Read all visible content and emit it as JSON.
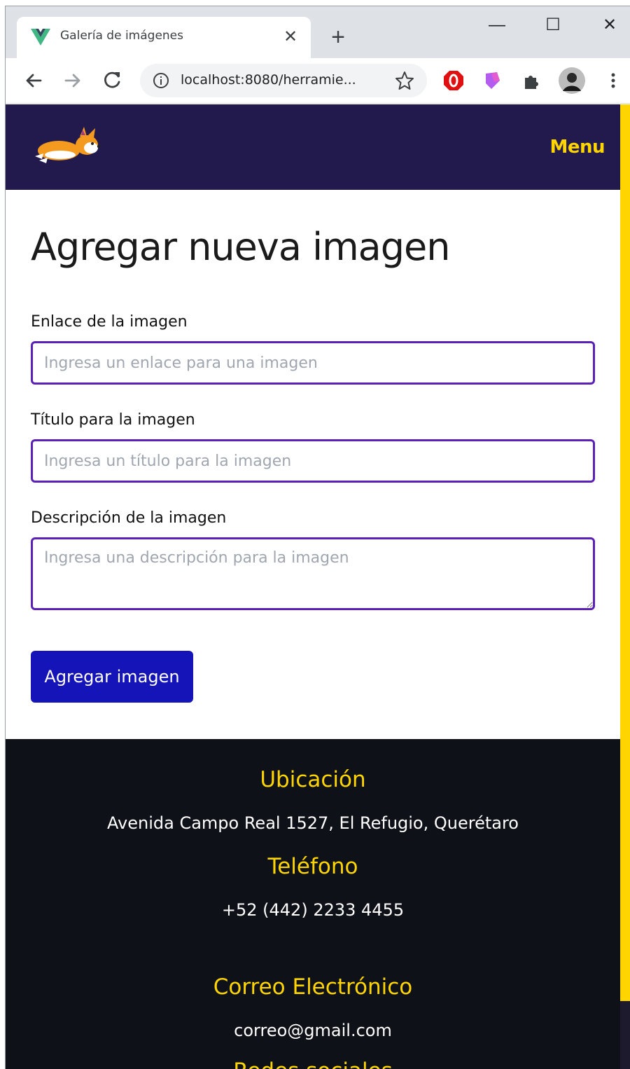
{
  "browser": {
    "tab_title": "Galería de imágenes",
    "tab_favicon": "vue-logo-icon",
    "url": "localhost:8080/herramie...",
    "window_controls": {
      "minimize": "—",
      "maximize": "☐",
      "close": "✕"
    },
    "tab_close": "✕",
    "new_tab": "+"
  },
  "navbar": {
    "logo": "corgi-logo-icon",
    "menu_label": "Menu"
  },
  "form": {
    "title": "Agregar nueva imagen",
    "link_label": "Enlace de la imagen",
    "link_placeholder": "Ingresa un enlace para una imagen",
    "title_label": "Título para la imagen",
    "title_placeholder": "Ingresa un título para la imagen",
    "description_label": "Descripción de la imagen",
    "description_placeholder": "Ingresa una descripción para la imagen",
    "submit_label": "Agregar imagen"
  },
  "footer": {
    "location_heading": "Ubicación",
    "location_text": "Avenida Campo Real 1527, El Refugio, Querétaro",
    "phone_heading": "Teléfono",
    "phone_text": "+52 (442) 2233 4455",
    "email_heading": "Correo Electrónico",
    "email_text": "correo@gmail.com",
    "social_heading": "Redes sociales"
  },
  "colors": {
    "navbar_bg": "#221a4d",
    "accent_yellow": "#ffd500",
    "input_border": "#5b21b6",
    "button_bg": "#1414b8",
    "footer_bg": "#0f1118"
  }
}
